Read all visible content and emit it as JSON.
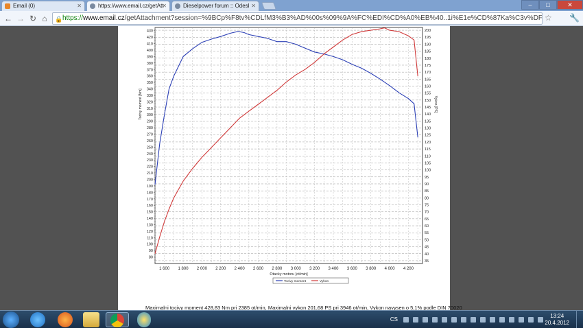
{
  "browser": {
    "tabs": [
      {
        "label": "Email (0)",
        "favicon_color": "#e8862a",
        "active": false
      },
      {
        "label": "https://www.email.cz/getAtt",
        "favicon_color": "#7a8aa0",
        "active": true
      },
      {
        "label": "Dieselpower forum :: Odesl",
        "favicon_color": "#7a8aa0",
        "active": false
      }
    ],
    "url_secure": "https://",
    "url_host": "www.email.cz",
    "url_rest": "/getAttachment?session=%9BCp%F8tv%CDLfM3%B3%AD%00s%09%9A%FC%EDI%CD%A0%EB%40..1i%E1e%CD%87Ka%C3v%DFI%DB%C0%F5%1C9%",
    "window_buttons": {
      "minimize": "–",
      "maximize": "□",
      "close": "✕"
    }
  },
  "chart_data": {
    "type": "line",
    "xlabel": "Otacky motoru [ot/min]",
    "ylabel_left": "Tocivy moment [Nm]",
    "ylabel_right": "Vykon [PS]",
    "xlim": [
      1500,
      4350
    ],
    "x_ticks": [
      "1 600",
      "1 800",
      "2 000",
      "2 200",
      "2 400",
      "2 600",
      "2 800",
      "3 000",
      "3 200",
      "3 400",
      "3 600",
      "3 800",
      "4 000",
      "4 200"
    ],
    "y_left_lim": [
      70,
      435
    ],
    "y_left_ticks": [
      80,
      90,
      100,
      110,
      120,
      130,
      140,
      150,
      160,
      170,
      180,
      190,
      200,
      210,
      220,
      230,
      240,
      250,
      260,
      270,
      280,
      290,
      300,
      310,
      320,
      330,
      340,
      350,
      360,
      370,
      380,
      390,
      400,
      410,
      420,
      430
    ],
    "y_right_lim": [
      33,
      202
    ],
    "y_right_ticks": [
      35,
      40,
      45,
      50,
      55,
      60,
      65,
      70,
      75,
      80,
      85,
      90,
      95,
      100,
      105,
      110,
      115,
      120,
      125,
      130,
      135,
      140,
      145,
      150,
      155,
      160,
      165,
      170,
      175,
      180,
      185,
      190,
      195,
      200
    ],
    "grid": true,
    "legend": [
      "Tocivy moment",
      "Vykon"
    ],
    "series": [
      {
        "name": "Tocivy moment",
        "axis": "left",
        "color": "#2b3fb5",
        "x": [
          1500,
          1550,
          1600,
          1650,
          1700,
          1800,
          1900,
          2000,
          2100,
          2200,
          2300,
          2385,
          2450,
          2500,
          2600,
          2700,
          2800,
          2900,
          3000,
          3100,
          3200,
          3300,
          3400,
          3500,
          3600,
          3700,
          3800,
          3900,
          4000,
          4100,
          4200,
          4260,
          4300
        ],
        "y": [
          192,
          255,
          300,
          340,
          360,
          390,
          402,
          412,
          417,
          421,
          426,
          428.8,
          427,
          424,
          421,
          418,
          413,
          413,
          409,
          403,
          397,
          394,
          390,
          385,
          378,
          372,
          364,
          355,
          345,
          334,
          325,
          317,
          265
        ]
      },
      {
        "name": "Vykon",
        "axis": "right",
        "color": "#d03a3a",
        "x": [
          1500,
          1550,
          1600,
          1650,
          1700,
          1800,
          1900,
          2000,
          2100,
          2200,
          2300,
          2400,
          2500,
          2600,
          2700,
          2800,
          2900,
          3000,
          3100,
          3200,
          3300,
          3400,
          3500,
          3600,
          3700,
          3800,
          3900,
          3946,
          4000,
          4100,
          4200,
          4260,
          4300
        ],
        "y": [
          40,
          52,
          63,
          72,
          80,
          92,
          101,
          109,
          116,
          123,
          130,
          137,
          142,
          147,
          152,
          157,
          163,
          168,
          172,
          177,
          183,
          188,
          193,
          197,
          199,
          200,
          201,
          201.7,
          200,
          199,
          196,
          193,
          167
        ]
      }
    ]
  },
  "caption": "Maximalni tocivy moment 428,83 Nm pri 2385 ot/min,  Maximalni vykon 201,68 PS pri 3946 ot/min,  Vykon navysen o 5,1% podle DIN 70020",
  "taskbar": {
    "lang": "CS",
    "time": "13:24",
    "date": "20.4.2012"
  }
}
